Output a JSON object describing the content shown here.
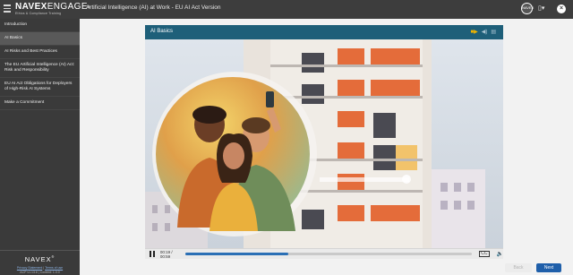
{
  "app": {
    "logo_main": "NAVEX",
    "logo_main_suffix": "ENGAGE",
    "logo_trademark": "®",
    "logo_sub": "Ethics & Compliance Training",
    "course_title": "Artificial Intelligence (AI) at Work - EU AI Act Version",
    "avatar_text": "NAVEX",
    "doc_label": "▯▾"
  },
  "sidebar": {
    "items": [
      {
        "label": "Introduction",
        "active": false
      },
      {
        "label": "AI Basics",
        "active": true
      },
      {
        "label": "AI Risks and Best Practices",
        "active": false
      },
      {
        "label": "The EU Artificial Intelligence (AI) Act: Risk and Responsibility",
        "active": false
      },
      {
        "label": "EU AI Act Obligations for Deployers of High-Risk AI Systems",
        "active": false
      },
      {
        "label": "Make a Commitment",
        "active": false
      }
    ],
    "footer_logo": "NAVEX",
    "footer_trademark": "®",
    "privacy_link": "Privacy Statement",
    "separator": "|",
    "terms_link": "Terms of use",
    "version_text": "ACP v1.13.6 | Content: 1.0.0"
  },
  "slide": {
    "title": "AI Basics",
    "icons": [
      "video-camera-icon",
      "volume-icon",
      "captions-icon"
    ]
  },
  "player": {
    "time": "00:19 / 00:59",
    "progress": 0.36,
    "cc_label": "CC",
    "speaker_label": "🔈"
  },
  "buttons": {
    "back": "Back",
    "next": "Next"
  },
  "colors": {
    "topbar": "#3d3d3d",
    "sidebar": "#3a3a3a",
    "slide_header": "#1e5f79",
    "progress": "#2a6fb5",
    "next_button": "#1f5faa"
  }
}
